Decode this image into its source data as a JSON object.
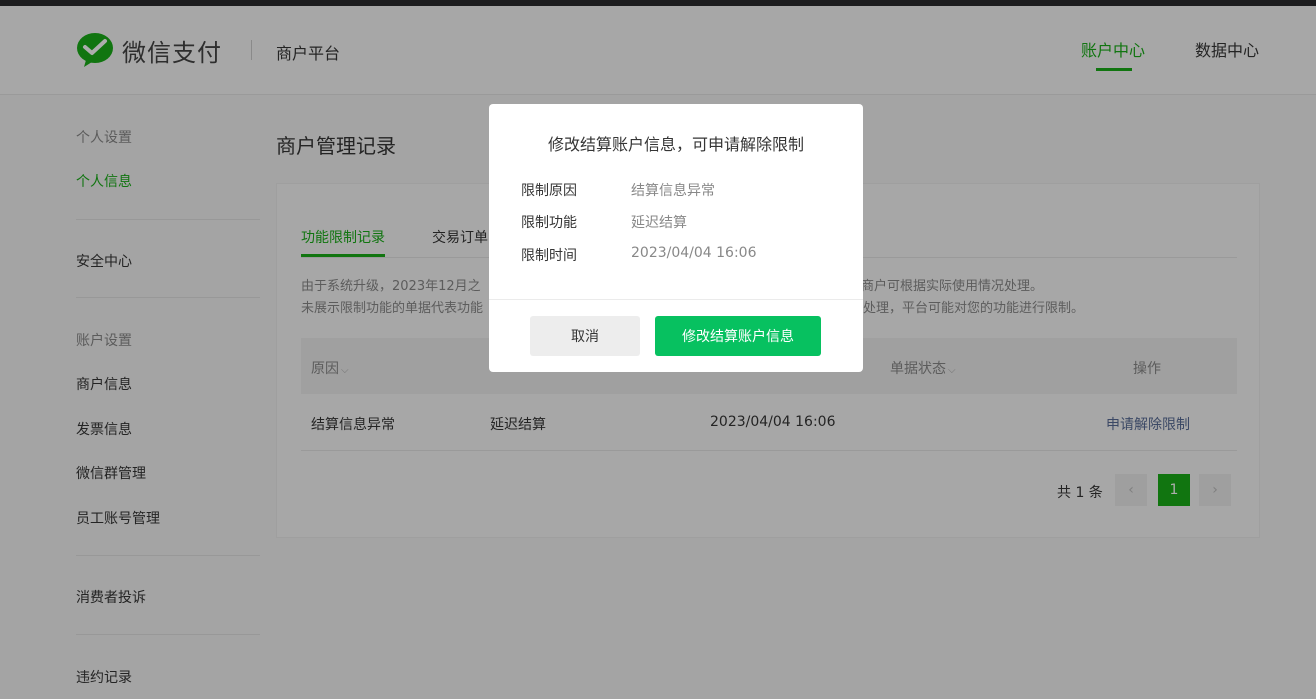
{
  "header": {
    "brand": "微信支付",
    "platform": "商户平台",
    "nav": [
      {
        "label": "账户中心",
        "active": true
      },
      {
        "label": "数据中心",
        "active": false
      }
    ]
  },
  "sidebar": {
    "group_personal": "个人设置",
    "personal_info": "个人信息",
    "security_center": "安全中心",
    "group_account": "账户设置",
    "merchant_info": "商户信息",
    "invoice_info": "发票信息",
    "wechat_group": "微信群管理",
    "staff_accounts": "员工账号管理",
    "consumer_complaints": "消费者投诉",
    "violation_records": "违约记录"
  },
  "main": {
    "title": "商户管理记录",
    "tabs": [
      "功能限制记录",
      "交易订单"
    ],
    "notice_line1_left": "由于系统升级，2023年12月之",
    "notice_line1_right": "，商户可根据实际使用情况处理。",
    "notice_line2_left": "未展示限制功能的单据代表功能",
    "notice_line2_right": "处理，平台可能对您的功能进行限制。",
    "table": {
      "headers": {
        "reason": "原因",
        "status": "单据状态",
        "action": "操作"
      },
      "rows": [
        {
          "reason": "结算信息异常",
          "function": "延迟结算",
          "time": "2023/04/04 16:06",
          "action": "申请解除限制"
        }
      ]
    },
    "pager": {
      "total": "共 1 条",
      "current": "1",
      "prev": "‹",
      "next": "›"
    }
  },
  "modal": {
    "title": "修改结算账户信息，可申请解除限制",
    "fields": [
      {
        "label": "限制原因",
        "value": "结算信息异常"
      },
      {
        "label": "限制功能",
        "value": "延迟结算"
      },
      {
        "label": "限制时间",
        "value": "2023/04/04 16:06"
      }
    ],
    "cancel": "取消",
    "confirm": "修改结算账户信息"
  },
  "colors": {
    "brand": "#1aad19",
    "primary_button": "#07c160",
    "link": "#576b95"
  }
}
